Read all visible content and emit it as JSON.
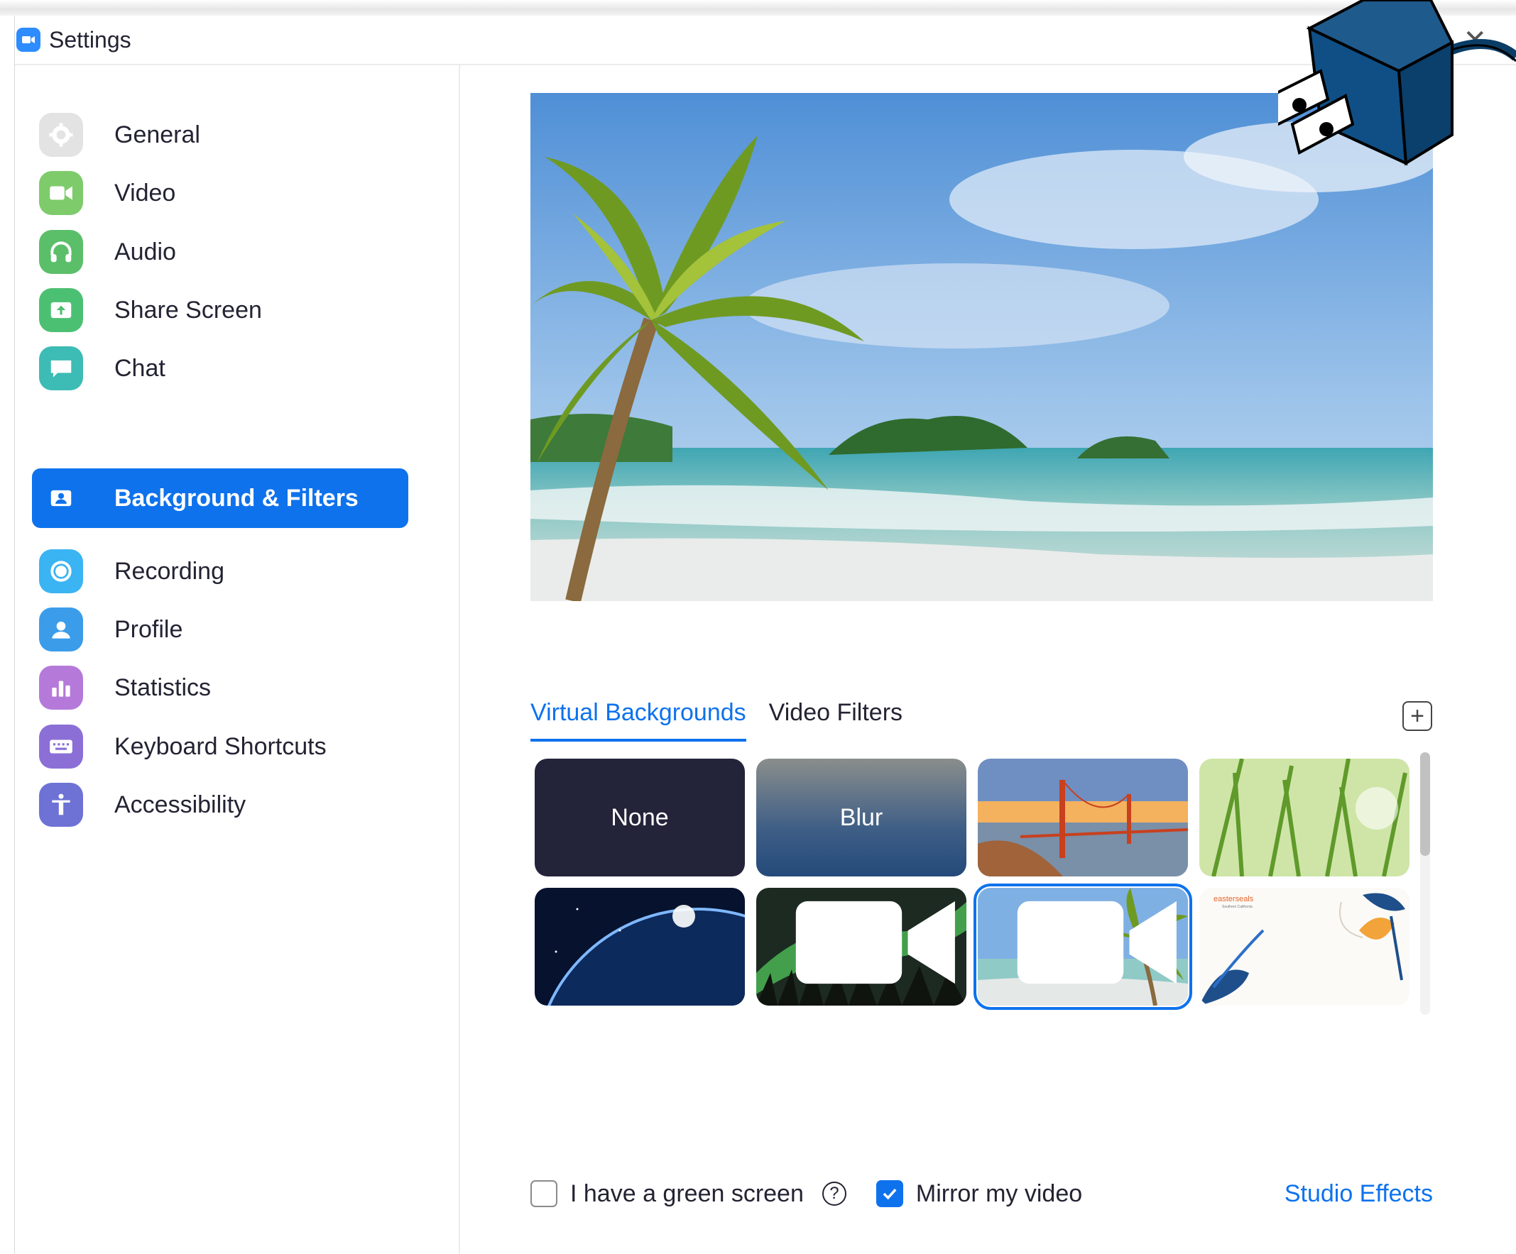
{
  "window": {
    "title": "Settings",
    "close_glyph": "✕"
  },
  "sidebar": {
    "items": [
      {
        "label": "General",
        "icon": "gear-icon",
        "color": "#e3e3e3"
      },
      {
        "label": "Video",
        "icon": "video-camera-icon",
        "color": "#7ecb6b"
      },
      {
        "label": "Audio",
        "icon": "headphones-icon",
        "color": "#5bbf6a"
      },
      {
        "label": "Share Screen",
        "icon": "share-screen-icon",
        "color": "#4cc072"
      },
      {
        "label": "Chat",
        "icon": "chat-bubble-icon",
        "color": "#3cbcb5"
      },
      {
        "label": "Background & Filters",
        "icon": "person-card-icon",
        "color": "#0e72ed"
      },
      {
        "label": "Recording",
        "icon": "record-icon",
        "color": "#3ab4f2"
      },
      {
        "label": "Profile",
        "icon": "profile-icon",
        "color": "#3b9dea"
      },
      {
        "label": "Statistics",
        "icon": "bar-chart-icon",
        "color": "#b57ad9"
      },
      {
        "label": "Keyboard Shortcuts",
        "icon": "keyboard-icon",
        "color": "#8b6fd6"
      },
      {
        "label": "Accessibility",
        "icon": "accessibility-icon",
        "color": "#6d72d4"
      }
    ]
  },
  "tabs": [
    {
      "label": "Virtual Backgrounds",
      "active": true
    },
    {
      "label": "Video Filters",
      "active": false
    }
  ],
  "add_button": {
    "glyph": "+"
  },
  "backgrounds": [
    {
      "label": "None"
    },
    {
      "label": "Blur"
    },
    {
      "label": ""
    },
    {
      "label": ""
    },
    {
      "label": ""
    },
    {
      "label": ""
    },
    {
      "label": ""
    },
    {
      "label": "",
      "brand_text": "easterseals",
      "brand_sub": "Southern California"
    }
  ],
  "options": {
    "green_screen_label": "I have a green screen",
    "help_glyph": "?",
    "mirror_label": "Mirror my video",
    "green_screen_checked": false,
    "mirror_checked": true,
    "studio_effects_label": "Studio Effects"
  },
  "colors": {
    "accent": "#0e72ed",
    "text": "#232333"
  }
}
